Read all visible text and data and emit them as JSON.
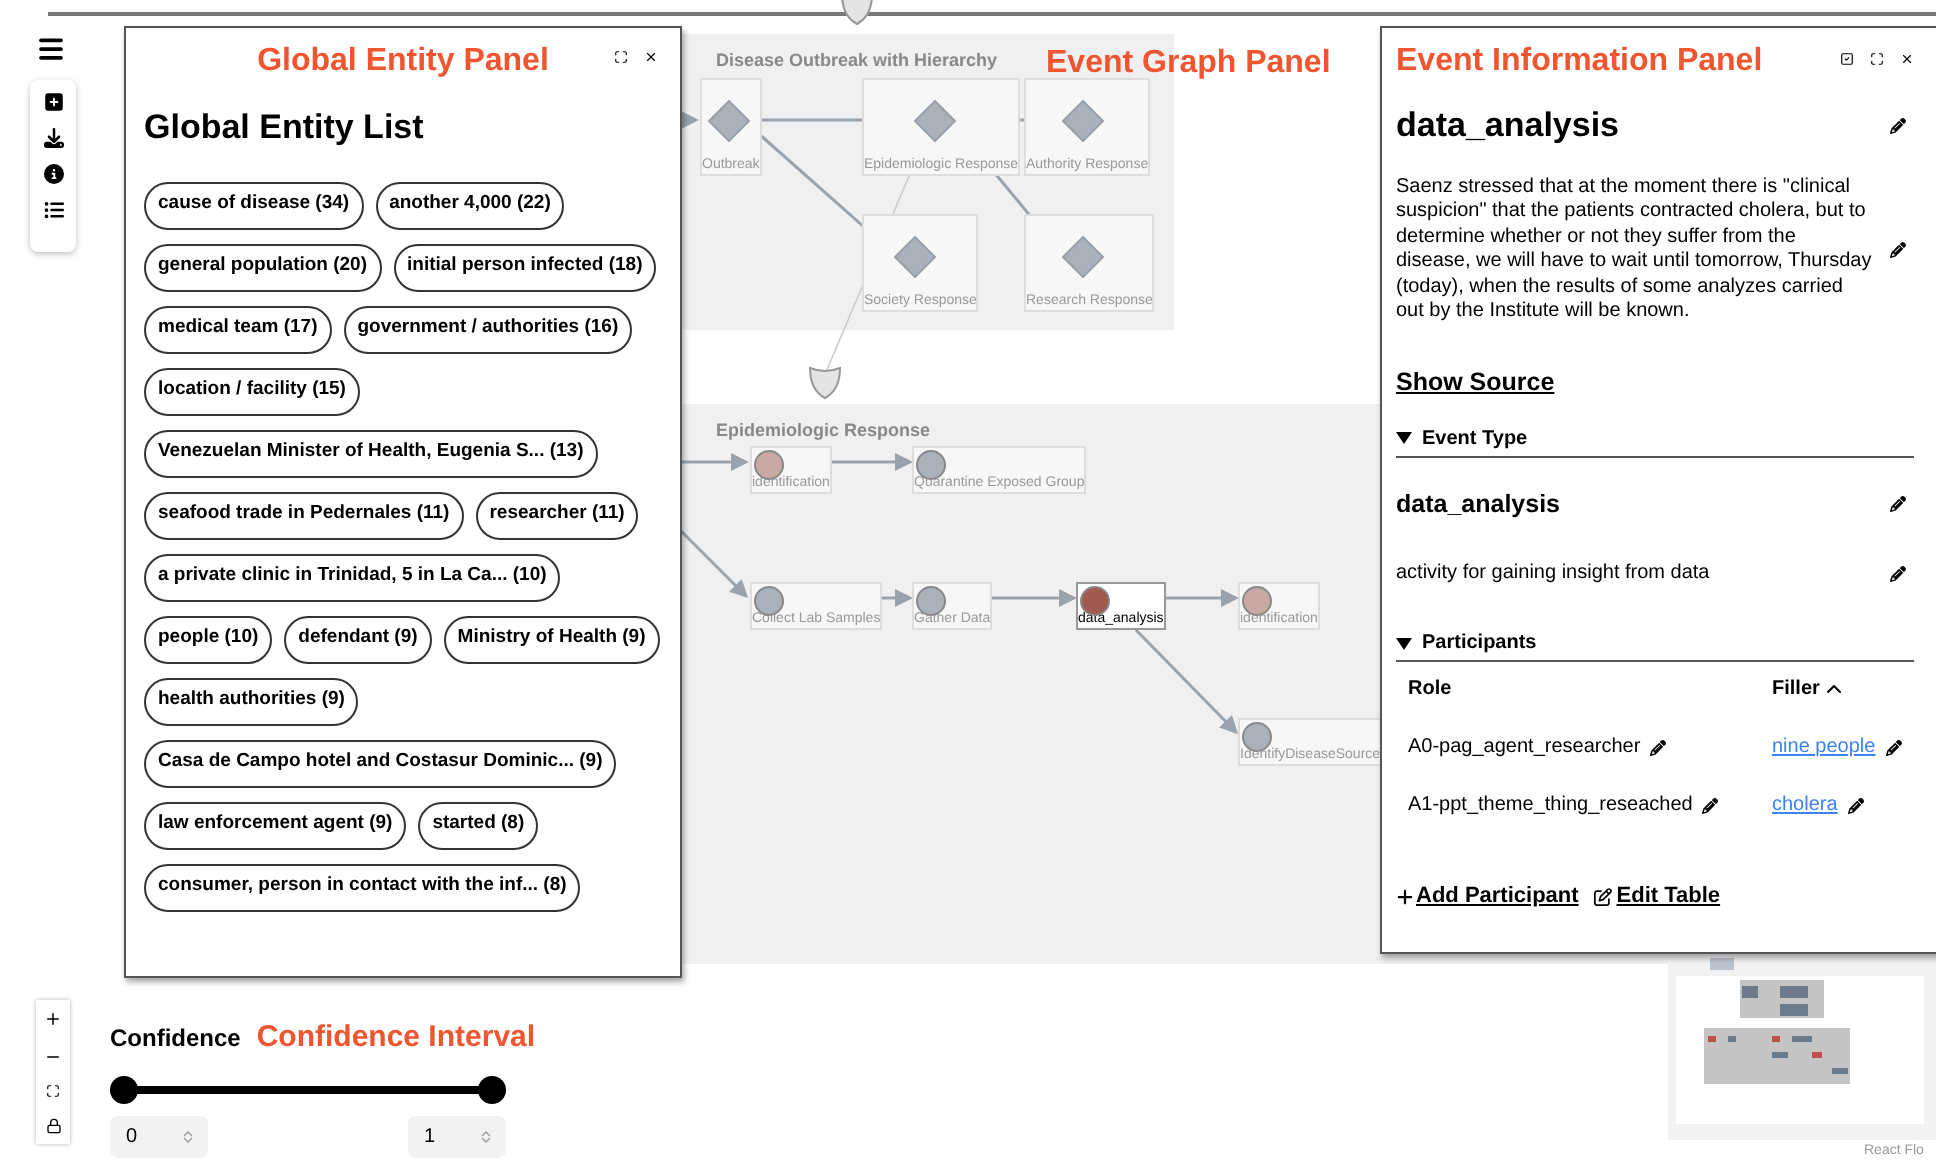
{
  "global_entity_panel": {
    "annotation": "Global Entity Panel",
    "title": "Global Entity List",
    "entities": [
      {
        "label": "cause of disease (34)"
      },
      {
        "label": "another 4,000 (22)"
      },
      {
        "label": "general population (20)"
      },
      {
        "label": "initial person infected (18)"
      },
      {
        "label": "medical team (17)"
      },
      {
        "label": "government / authorities (16)"
      },
      {
        "label": "location / facility (15)"
      },
      {
        "label": "Venezuelan Minister of Health, Eugenia S... (13)"
      },
      {
        "label": "seafood trade in Pedernales (11)"
      },
      {
        "label": "researcher (11)"
      },
      {
        "label": "a private clinic in Trinidad, 5 in La Ca... (10)"
      },
      {
        "label": "people (10)"
      },
      {
        "label": "defendant (9)"
      },
      {
        "label": "Ministry of Health (9)"
      },
      {
        "label": "health authorities (9)"
      },
      {
        "label": "Casa de Campo hotel and Costasur Dominic... (9)"
      },
      {
        "label": "law enforcement agent (9)"
      },
      {
        "label": "started (8)"
      },
      {
        "label": "consumer, person in contact with the inf... (8)"
      }
    ]
  },
  "event_graph_panel": {
    "annotation": "Event Graph Panel",
    "groups": [
      {
        "title": "Disease Outbreak with Hierarchy",
        "nodes": [
          {
            "label": "Outbreak",
            "kind": "diamond",
            "color": "#aab1b8",
            "selected": false
          },
          {
            "label": "Epidemiologic Response",
            "kind": "diamond",
            "color": "#aab1b8",
            "selected": false
          },
          {
            "label": "Authority Response",
            "kind": "diamond",
            "color": "#aab1b8",
            "selected": false
          },
          {
            "label": "Society Response",
            "kind": "diamond",
            "color": "#aab1b8",
            "selected": false
          },
          {
            "label": "Research Response",
            "kind": "diamond",
            "color": "#aab1b8",
            "selected": false
          }
        ]
      },
      {
        "title": "Epidemiologic Response",
        "nodes": [
          {
            "label": "identification",
            "kind": "circle",
            "color": "#c9a9a4",
            "selected": false
          },
          {
            "label": "Quarantine Exposed Group",
            "kind": "circle",
            "color": "#aab1b8",
            "selected": false
          },
          {
            "label": "Collect Lab Samples",
            "kind": "circle",
            "color": "#aab1b8",
            "selected": false
          },
          {
            "label": "Gather Data",
            "kind": "circle",
            "color": "#aab1b8",
            "selected": false
          },
          {
            "label": "data_analysis",
            "kind": "circle",
            "color": "#a05a50",
            "selected": true
          },
          {
            "label": "identification",
            "kind": "circle",
            "color": "#c9a9a4",
            "selected": false
          },
          {
            "label": "IdentifyDiseaseSource",
            "kind": "circle",
            "color": "#aab1b8",
            "selected": false
          }
        ]
      }
    ]
  },
  "event_information_panel": {
    "annotation": "Event Information Panel",
    "title": "data_analysis",
    "description": "Saenz stressed that at the moment there is \"clinical suspicion\" that the patients contracted cholera, but to determine whether or not they suffer from the disease, we will have to wait until tomorrow, Thursday (today), when the results of some analyzes carried out by the Institute will be known.",
    "show_source": "Show Source",
    "event_type": {
      "heading": "Event Type",
      "expanded": true,
      "name": "data_analysis",
      "definition": "activity for gaining insight from data"
    },
    "participants": {
      "heading": "Participants",
      "expanded": true,
      "columns": [
        "Role",
        "Filler"
      ],
      "rows": [
        {
          "role": "A0-pag_agent_researcher",
          "filler": "nine people"
        },
        {
          "role": "A1-ppt_theme_thing_reseached",
          "filler": "cholera"
        }
      ],
      "add_button": "Add Participant",
      "edit_button": "Edit Table"
    }
  },
  "confidence": {
    "label": "Confidence",
    "annotation": "Confidence Interval",
    "low": {
      "level": 0,
      "value": "0"
    },
    "high": {
      "level": 1,
      "value": "1"
    }
  },
  "attribution": "React Flo"
}
